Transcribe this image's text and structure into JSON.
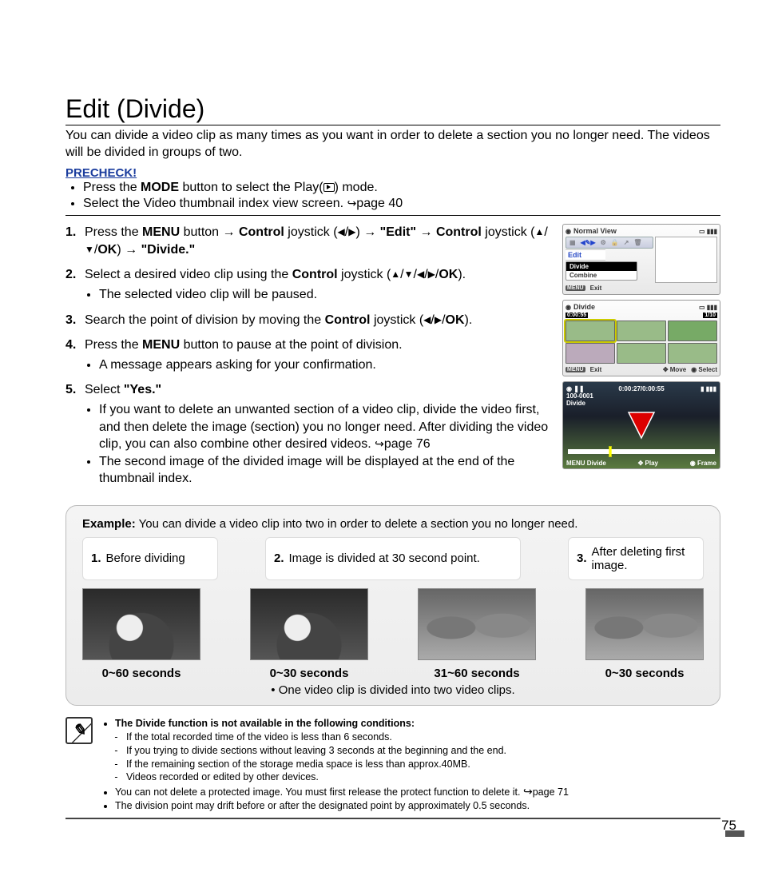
{
  "title": "Edit (Divide)",
  "intro": "You can divide a video clip as many times as you want in order to delete a section you no longer need. The videos will be divided in groups of two.",
  "precheck": {
    "heading": "PRECHECK!",
    "items": {
      "p1a": "Press the ",
      "p1b": "MODE",
      "p1c": " button to select the Play(",
      "p1d": ") mode.",
      "p2": "Select the Video thumbnail index view screen. ",
      "p2ref": "page 40"
    }
  },
  "steps": {
    "s1": {
      "n": "1.",
      "a": "Press the ",
      "b": "MENU",
      "c": " button ",
      "arr": "→",
      "d": " Control",
      "e": " joystick (",
      "f": "◀",
      "g": "/",
      "h": "▶",
      "i": ") ",
      "j": "→",
      "k": " \"Edit\"",
      "l": " → ",
      "m": "Control",
      "o": "joystick (",
      "p": "▲",
      "q": "/",
      "r": "▼",
      "s": "/",
      "t": "OK",
      "u": ") ",
      "v": "→",
      "w": " \"Divide.\""
    },
    "s2": {
      "n": "2.",
      "a": "Select a desired video clip using the ",
      "b": "Control",
      "c": " joystick (",
      "d": "▲",
      "e": "/",
      "f": "▼",
      "g": "/",
      "h": "◀",
      "i": "/",
      "j": "▶",
      "k": "/",
      "l": "OK",
      "m": ").",
      "sub1": "The selected video clip will be paused."
    },
    "s3": {
      "n": "3.",
      "a": "Search the point of division by moving the ",
      "b": "Control",
      "c": " joystick (",
      "d": "◀",
      "e": "/",
      "f": "▶",
      "g": "/",
      "h": "OK",
      "i": ")."
    },
    "s4": {
      "n": "4.",
      "a": "Press the ",
      "b": "MENU",
      "c": " button to pause at the point of division.",
      "sub1": "A message appears asking for your confirmation."
    },
    "s5": {
      "n": "5.",
      "a": "Select ",
      "b": "\"Yes.\"",
      "sub1": "If you want to delete an unwanted section of a video clip, divide the video first, and then delete the image (section) you no longer need. After dividing the video clip, you can also combine other desired videos. ",
      "sub1ref": "page 76",
      "sub2": "The second image of the divided image will be displayed at the end of the thumbnail index."
    }
  },
  "screens": {
    "s1": {
      "title": "Normal View",
      "toolbar_active": "Edit",
      "menu": [
        "Divide",
        "Combine"
      ],
      "menu_sel": 0,
      "footer_menu": "MENU",
      "footer_exit": "Exit"
    },
    "s2": {
      "title": "Divide",
      "timecode": "0:00:55",
      "counter": "1/10",
      "footer_menu": "MENU",
      "footer_exit": "Exit",
      "footer_move": "Move",
      "footer_select": "Select"
    },
    "s3": {
      "timecode": "0:00:27/0:00:55",
      "folder": "100-0001",
      "label": "Divide",
      "foot_menu": "MENU",
      "foot_divide": "Divide",
      "foot_play": "Play",
      "foot_frame": "Frame"
    }
  },
  "example": {
    "heading_bold": "Example:",
    "heading_rest": " You can divide a video clip into two in order to delete a section you no longer need.",
    "step1": {
      "n": "1.",
      "t": "Before dividing"
    },
    "step2": {
      "n": "2.",
      "t": "Image is divided at 30 second point."
    },
    "step3": {
      "n": "3.",
      "t": "After deleting first image."
    },
    "cap1": "0~60 seconds",
    "cap2": "0~30 seconds",
    "cap3": "31~60 seconds",
    "cap4": "0~30 seconds",
    "bottom": "One video clip is divided into two video clips."
  },
  "notes": {
    "head": "The Divide function is not available in the following conditions:",
    "sub": [
      "If the total recorded time of the video is less than 6 seconds.",
      "If you trying to divide sections without leaving 3 seconds at the beginning and the end.",
      "If the remaining section of the storage media space is less than approx.40MB.",
      "Videos recorded or edited by other devices."
    ],
    "b2a": "You can not delete a protected image. You must first release the protect function to delete it. ",
    "b2ref": "page 71",
    "b3": "The division point may drift before or after the designated point by approximately 0.5 seconds."
  },
  "page_number": "75"
}
